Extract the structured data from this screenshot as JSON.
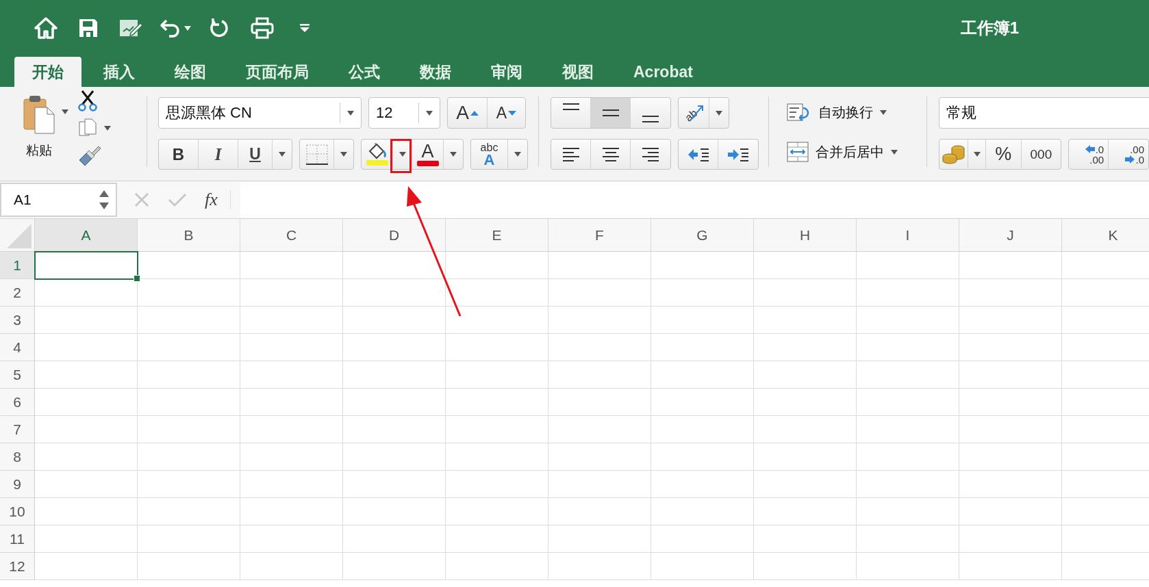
{
  "window": {
    "title": "工作簿1"
  },
  "tabs": [
    {
      "label": "开始",
      "selected": true
    },
    {
      "label": "插入",
      "selected": false
    },
    {
      "label": "绘图",
      "selected": false
    },
    {
      "label": "页面布局",
      "selected": false
    },
    {
      "label": "公式",
      "selected": false
    },
    {
      "label": "数据",
      "selected": false
    },
    {
      "label": "审阅",
      "selected": false
    },
    {
      "label": "视图",
      "selected": false
    },
    {
      "label": "Acrobat",
      "selected": false
    }
  ],
  "ribbon": {
    "clipboard": {
      "paste_label": "粘贴"
    },
    "font": {
      "name": "思源黑体 CN",
      "size": "12",
      "grow": "A",
      "shrink": "A",
      "bold": "B",
      "italic": "I",
      "underline": "U",
      "font_color": "A",
      "styles_top": "abc",
      "styles_bottom": "A"
    },
    "alignment": {
      "orientation": "ab",
      "vertical": [
        {
          "selected": false
        },
        {
          "selected": true
        },
        {
          "selected": false
        }
      ],
      "wrap_text": "自动换行",
      "merge_center": "合并后居中"
    },
    "number": {
      "format": "常规",
      "percent": "%",
      "thousands": "000",
      "increase_decimal": {
        "top": ".0",
        "bottom": ".00"
      },
      "decrease_decimal": {
        "top": ".00",
        "bottom": ".0"
      }
    }
  },
  "formula_bar": {
    "name_box": "A1",
    "fx": "fx"
  },
  "sheet": {
    "columns": [
      {
        "label": "A",
        "selected": true
      },
      {
        "label": "B",
        "selected": false
      },
      {
        "label": "C",
        "selected": false
      },
      {
        "label": "D",
        "selected": false
      },
      {
        "label": "E",
        "selected": false
      },
      {
        "label": "F",
        "selected": false
      },
      {
        "label": "G",
        "selected": false
      },
      {
        "label": "H",
        "selected": false
      },
      {
        "label": "I",
        "selected": false
      },
      {
        "label": "J",
        "selected": false
      },
      {
        "label": "K",
        "selected": false
      }
    ],
    "rows": [
      {
        "label": "1",
        "selected": true
      },
      {
        "label": "2",
        "selected": false
      },
      {
        "label": "3",
        "selected": false
      },
      {
        "label": "4",
        "selected": false
      },
      {
        "label": "5",
        "selected": false
      },
      {
        "label": "6",
        "selected": false
      },
      {
        "label": "7",
        "selected": false
      },
      {
        "label": "8",
        "selected": false
      },
      {
        "label": "9",
        "selected": false
      },
      {
        "label": "10",
        "selected": false
      },
      {
        "label": "11",
        "selected": false
      },
      {
        "label": "12",
        "selected": false
      }
    ]
  }
}
